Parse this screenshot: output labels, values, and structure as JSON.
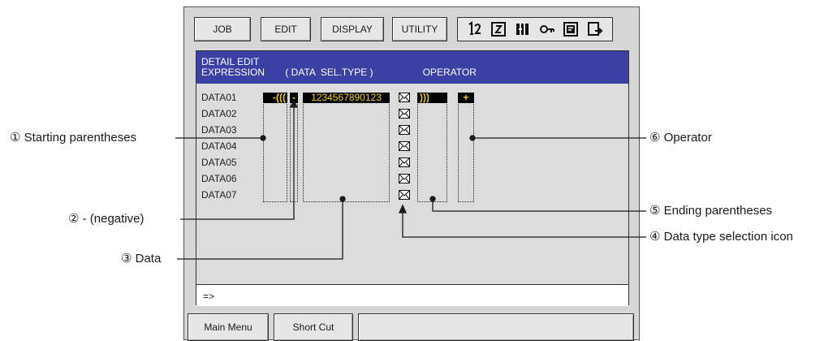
{
  "menu": {
    "job": "JOB",
    "edit": "EDIT",
    "display": "DISPLAY",
    "utility": "UTILITY"
  },
  "icons": [
    "step-icon",
    "interlock-icon",
    "manipulator-icon",
    "security-key-icon",
    "teach-icon",
    "coordinate-icon"
  ],
  "screen": {
    "title_line1": "DETAIL EDIT",
    "col_expression": "EXPRESSION",
    "col_data_sel": "( DATA  SEL.TYPE )",
    "col_operator": "OPERATOR",
    "rows": [
      "DATA01",
      "DATA02",
      "DATA03",
      "DATA04",
      "DATA05",
      "DATA06",
      "DATA07"
    ],
    "row1_paren": "-(((",
    "row1_neg": "-",
    "row1_data": "1234567890123",
    "row1_end_paren": ")))",
    "row1_operator": "+",
    "input_prompt": "=>"
  },
  "bottom": {
    "main_menu": "Main Menu",
    "short_cut": "Short Cut"
  },
  "callouts": {
    "c1": "① Starting parentheses",
    "c2": "② - (negative)",
    "c3": "③ Data",
    "c4": "④ Data type selection icon",
    "c5": "⑤ Ending parentheses",
    "c6": "⑥ Operator"
  },
  "colors": {
    "title_bar": "#3a41a2",
    "highlight_bg": "#000000",
    "highlight_text": "#f3d200"
  }
}
